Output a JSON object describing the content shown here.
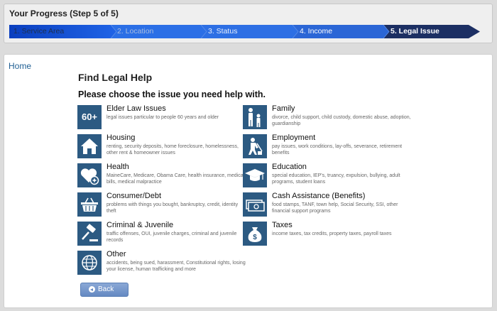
{
  "progress": {
    "title": "Your Progress (Step 5 of 5)",
    "steps": [
      {
        "label": "1. Service Area",
        "state": "done"
      },
      {
        "label": "2. Location",
        "state": "future"
      },
      {
        "label": "3. Status",
        "state": "future"
      },
      {
        "label": "4. Income",
        "state": "future"
      },
      {
        "label": "5. Legal Issue",
        "state": "current"
      }
    ]
  },
  "nav": {
    "home": "Home"
  },
  "page": {
    "title": "Find Legal Help",
    "subtitle": "Please choose the issue you need help with."
  },
  "issues": [
    {
      "name": "Elder Law Issues",
      "desc": "legal issues particular to people 60 years and older",
      "icon": "60-plus-icon",
      "icon_text": "60+"
    },
    {
      "name": "Family",
      "desc": "divorce, child support, child custody, domestic abuse, adoption, guardianship",
      "icon": "family-icon"
    },
    {
      "name": "Housing",
      "desc": "renting, security deposits, home foreclosure, homelessness, other rent & homeowner issues",
      "icon": "house-icon"
    },
    {
      "name": "Employment",
      "desc": "pay issues, work conditions, lay-offs, severance, retirement benefits",
      "icon": "worker-icon"
    },
    {
      "name": "Health",
      "desc": "MaineCare, Medicare, Obama Care, health insurance, medical bills, medical malpractice",
      "icon": "heart-plus-icon"
    },
    {
      "name": "Education",
      "desc": "special education, IEP's, truancy, expulsion, bullying, adult programs, student loans",
      "icon": "graduation-cap-icon"
    },
    {
      "name": "Consumer/Debt",
      "desc": "problems with things you bought, bankruptcy, credit, identity theft",
      "icon": "shopping-basket-icon"
    },
    {
      "name": "Cash Assistance (Benefits)",
      "desc": "food stamps, TANF, town help, Social Security, SSI, other financial support programs",
      "icon": "cash-icon"
    },
    {
      "name": "Criminal & Juvenile",
      "desc": "traffic offenses, OUI, juvenile charges, criminal and juvenile records",
      "icon": "gavel-icon"
    },
    {
      "name": "Taxes",
      "desc": "income taxes, tax credits, property taxes, payroll taxes",
      "icon": "money-bag-icon"
    },
    {
      "name": "Other",
      "desc": "accidents, being sued, harassment, Constitutional rights, losing your license, human trafficking and more",
      "icon": "globe-icon"
    }
  ],
  "back": {
    "label": "Back"
  },
  "colors": {
    "step_done": "#0d47c6",
    "step_active": "#1c2f63",
    "step_future": "#2a6de3",
    "icon_bg": "#2c5a82",
    "link": "#1f5f93"
  }
}
